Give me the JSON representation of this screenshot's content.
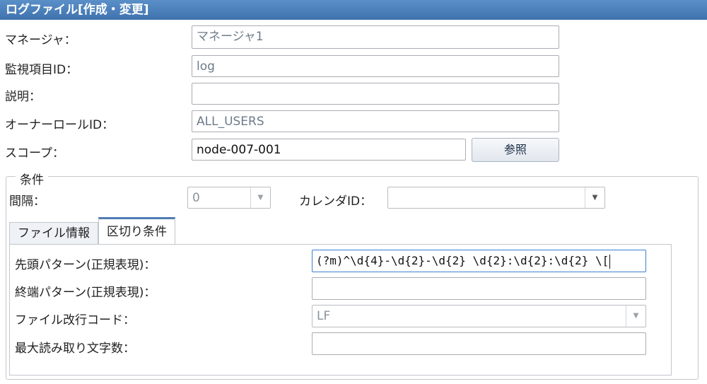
{
  "window": {
    "title": "ログファイル[作成・変更]"
  },
  "form": {
    "manager": {
      "label": "マネージャ：",
      "value": "マネージャ1"
    },
    "monitor_id": {
      "label": "監視項目ID：",
      "value": "log"
    },
    "description": {
      "label": "説明：",
      "value": ""
    },
    "owner_role": {
      "label": "オーナーロールID：",
      "value": "ALL_USERS"
    },
    "scope": {
      "label": "スコープ：",
      "value": "node-007-001",
      "button_label": "参照"
    }
  },
  "conditions": {
    "legend": "条件",
    "interval": {
      "label": "間隔：",
      "value": "0"
    },
    "calendar": {
      "label": "カレンダID：",
      "value": ""
    }
  },
  "tabs": [
    {
      "label": "ファイル情報",
      "active": false
    },
    {
      "label": "区切り条件",
      "active": true
    }
  ],
  "delimiter": {
    "start_pattern": {
      "label": "先頭パターン(正規表現)：",
      "value": "(?m)^\\d{4}-\\d{2}-\\d{2} \\d{2}:\\d{2}:\\d{2} \\["
    },
    "end_pattern": {
      "label": "終端パターン(正規表現)：",
      "value": ""
    },
    "line_code": {
      "label": "ファイル改行コード：",
      "value": "LF"
    },
    "max_chars": {
      "label": "最大読み取り文字数：",
      "value": ""
    }
  },
  "icons": {
    "dropdown": "chevron-down-icon"
  },
  "colors": {
    "title_bar": "#4a7fbb",
    "active_tab_accent": "#4f7db3"
  }
}
